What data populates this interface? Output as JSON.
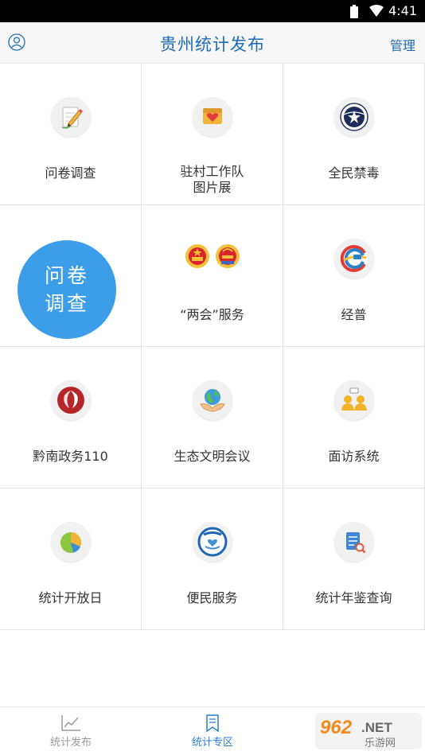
{
  "status_bar": {
    "time": "4:41"
  },
  "header": {
    "title": "贵州统计发布",
    "manage_label": "管理"
  },
  "grid": {
    "items": [
      {
        "label": "问卷调查",
        "icon": "pencil-notepad-icon"
      },
      {
        "label_line1": "驻村工作队",
        "label_line2": "图片展",
        "icon": "heart-card-icon"
      },
      {
        "label": "全民禁毒",
        "icon": "anti-drug-emblem-icon"
      },
      {
        "label": "",
        "icon": ""
      },
      {
        "label": "“两会”服务",
        "icon": "two-sessions-emblems-icon"
      },
      {
        "label": "经普",
        "icon": "economic-census-logo-icon"
      },
      {
        "label": "黔南政务110",
        "icon": "red-flame-logo-icon"
      },
      {
        "label": "生态文明会议",
        "icon": "globe-hands-icon"
      },
      {
        "label": "面访系统",
        "icon": "interview-people-icon"
      },
      {
        "label": "统计开放日",
        "icon": "pie-chart-icon"
      },
      {
        "label": "便民服务",
        "icon": "heart-hand-emblem-icon"
      },
      {
        "label": "统计年鉴查询",
        "icon": "document-search-icon"
      }
    ]
  },
  "floating_button": {
    "line1": "问卷",
    "line2": "调查"
  },
  "bottom_nav": {
    "tabs": [
      {
        "label": "统计发布",
        "icon": "line-chart-icon",
        "active": false
      },
      {
        "label": "统计专区",
        "icon": "bookmark-doc-icon",
        "active": true
      }
    ]
  },
  "watermark": {
    "text_main": "962.NET",
    "text_sub": "乐游网"
  },
  "colors": {
    "brand_blue": "#1f6bb2",
    "fab_blue": "#3c9ee8",
    "active_tab": "#2a7fd4"
  }
}
